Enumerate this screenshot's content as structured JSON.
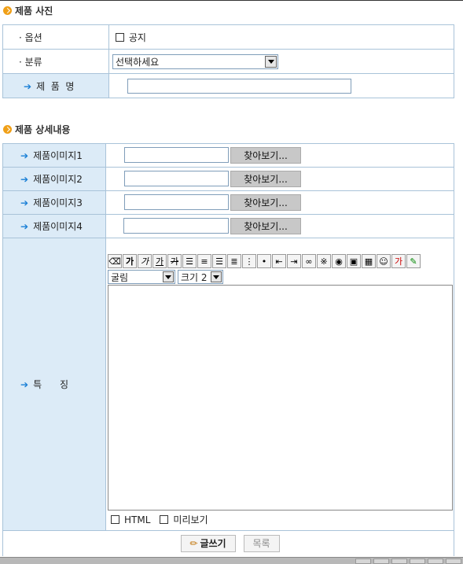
{
  "sections": {
    "photo_title": "제품 사진",
    "detail_title": "제품 상세내용"
  },
  "photo_form": {
    "option_label": "· 옵션",
    "notice_label": "공지",
    "category_label": "· 분류",
    "category_selected": "선택하세요",
    "product_name_label": "제  품  명",
    "product_name_value": ""
  },
  "detail_form": {
    "images": [
      {
        "label": "제품이미지1",
        "button": "찾아보기..."
      },
      {
        "label": "제품이미지2",
        "button": "찾아보기..."
      },
      {
        "label": "제품이미지3",
        "button": "찾아보기..."
      },
      {
        "label": "제품이미지4",
        "button": "찾아보기..."
      }
    ],
    "feature_label": "특      징",
    "font_selected": "굴림",
    "size_selected": "크기 2",
    "html_label": "HTML",
    "preview_label": "미리보기"
  },
  "actions": {
    "write_label": "글쓰기",
    "list_label": "목록"
  },
  "toolbar_icons": [
    "eraser-icon",
    "bold-icon",
    "italic-icon",
    "underline-icon",
    "strikethrough-icon",
    "align-left-icon",
    "align-center-icon",
    "align-right-icon",
    "justify-icon",
    "ordered-list-icon",
    "unordered-list-icon",
    "outdent-icon",
    "indent-icon",
    "link-icon",
    "unlink-icon",
    "image-icon",
    "picture-icon",
    "table-icon",
    "emoticon-icon",
    "text-color-icon",
    "highlight-icon"
  ],
  "colors": {
    "border": "#a9c3d9",
    "label_bg": "#dcebf7",
    "accent": "#1a7fd6",
    "bullet": "#f0a018"
  }
}
